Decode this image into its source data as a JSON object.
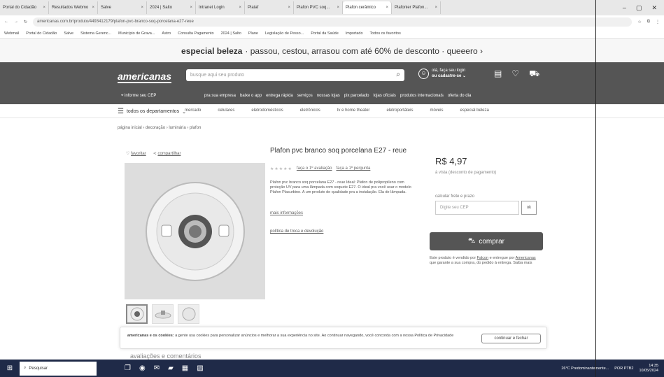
{
  "browser": {
    "tabs": [
      "Portal do Cidadão",
      "Resultados Webmo",
      "Salve",
      "2024 | Salto",
      "Intranet Login",
      "Plataf",
      "Plafon PVC soq...",
      "Plafon cerâmico",
      "Plafonier Plafon..."
    ],
    "url": "americanas.com.br/produto/4493412179/plafon-pvc-branco-soq-porcelana-e27-reue",
    "bookmarks": [
      "Webmail",
      "Portal do Cidadão",
      "Salve",
      "Sistema Gerenc...",
      "Município de Grava...",
      "Astro",
      "Consulta Pagamento",
      "2024 | Salto",
      "Plane",
      "Legislação de Pesso...",
      "Portal da Saúde",
      "Importado",
      "Todos os favoritos"
    ]
  },
  "promo": {
    "bold": "especial beleza",
    "text": "· passou, cestou, arrasou com até 60% de desconto · queeero ›"
  },
  "header": {
    "logo": "americanas",
    "search_placeholder": "busque aqui seu produto",
    "login_line1": "olá, faça seu login",
    "login_line2": "ou cadastre-se ⌄",
    "cep": "informe seu CEP",
    "links": [
      "pra sua empresa",
      "baixe o app",
      "entrega rápida",
      "serviços",
      "nossas lojas",
      "pix parcelado",
      "lojas oficiais",
      "produtos internacionais",
      "oferta do dia"
    ]
  },
  "catbar": {
    "departments": "todos os departamentos",
    "items": [
      "mercado",
      "celulares",
      "eletrodomésticos",
      "eletrônicos",
      "tv e home theater",
      "eletroportáteis",
      "móveis",
      "especial beleza"
    ]
  },
  "breadcrumb": "página inicial › decoração › luminária › plafon",
  "product": {
    "fav": "favoritar",
    "share": "compartilhar",
    "title": "Plafon pvc branco soq porcelana E27 - reue",
    "review1": "faça o 1º avaliação",
    "review2": "faça a 1º pergunta",
    "description": "Plafon pvc branco soq porcelana E27 - reue Ideal: Plafon de polipropileno com proteção UV para uma lâmpada com soquete E27. O ideal pra você usar o modelo Plafon Plasurbino. A um produto de qualidade pra a instalação. Ela de lâmpada.",
    "more": "mais informações",
    "policy": "política de troca e devolução",
    "price": "R$ 4,97",
    "installment": "à vista (desconto de pagamento)",
    "calc_label": "calcular frete e prazo",
    "cep_placeholder": "Digite seu CEP",
    "ok": "ok",
    "buy": "comprar",
    "seller_pre": "Este produto é vendido por",
    "seller_name": "Falcon",
    "seller_mid": "e entregue por",
    "seller_brand": "Americanas",
    "seller_post": "que garante a sua compra, do pedido à entrega. Saiba mais"
  },
  "cookie": {
    "bold": "americanas e os cookies:",
    "text": "a gente usa cookies para personalizar anúncios e melhorar a sua experiência no site. Ao continuar navegando, você concorda com a nossa Política de Privacidade",
    "button": "continuar e fechar"
  },
  "bottom_text": "avaliações e comentários",
  "taskbar": {
    "search": "Pesquisar",
    "weather": "26°C Predominantemente...",
    "lang": "POR PTB2",
    "time": "14:35",
    "date": "10/05/2024"
  }
}
